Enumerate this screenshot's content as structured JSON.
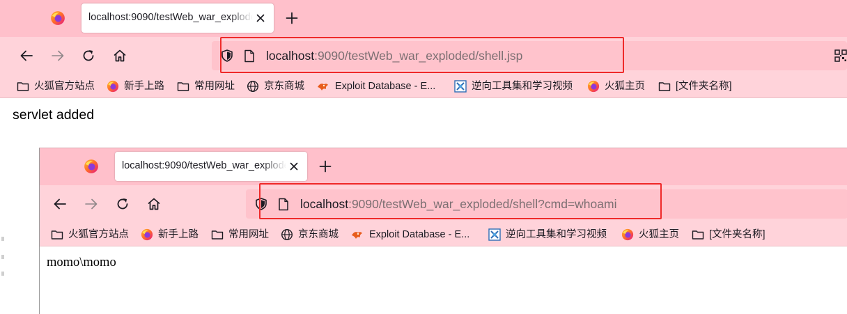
{
  "window1": {
    "tab": {
      "title": "localhost:9090/testWeb_war_exploded/shell.jsp",
      "icon": "firefox-icon"
    },
    "url": {
      "host": "localhost",
      "rest": ":9090/testWeb_war_exploded/shell.jsp"
    },
    "page": {
      "text": "servlet added"
    }
  },
  "window2": {
    "tab": {
      "title": "localhost:9090/testWeb_war_exploded/shell?cmd=whoami",
      "icon": "firefox-icon"
    },
    "url": {
      "host": "localhost",
      "rest": ":9090/testWeb_war_exploded/shell?cmd=whoami"
    },
    "page": {
      "text": "momo\\momo"
    }
  },
  "bookmarks": [
    {
      "label": "火狐官方站点",
      "icon": "folder-icon"
    },
    {
      "label": "新手上路",
      "icon": "firefox-icon"
    },
    {
      "label": "常用网址",
      "icon": "folder-icon"
    },
    {
      "label": "京东商城",
      "icon": "globe-icon"
    },
    {
      "label": "Exploit Database - E...",
      "icon": "exploit-db-icon"
    },
    {
      "label": "逆向工具集和学习视频",
      "icon": "reverse-tools-icon"
    },
    {
      "label": "火狐主页",
      "icon": "firefox-icon"
    },
    {
      "label": "[文件夹名称]",
      "icon": "folder-icon"
    }
  ],
  "colors": {
    "tabbar": "#ffc0cb",
    "toolbar": "#ffd3da",
    "urlbar": "#ffc3cc",
    "highlight_box": "#ef2a2a"
  }
}
